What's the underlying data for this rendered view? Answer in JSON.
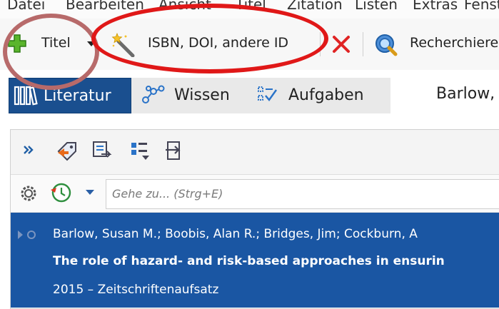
{
  "menubar": {
    "items": [
      "Datei",
      "Bearbeiten",
      "Ansicht",
      "Titel",
      "Zitation",
      "Listen",
      "Extras",
      "Fenster"
    ]
  },
  "toolbar": {
    "new_title_label": "Titel",
    "isbn_label": "ISBN, DOI, andere ID",
    "research_label": "Recherchieren"
  },
  "tabs": {
    "literature": "Literatur",
    "knowledge": "Wissen",
    "tasks": "Aufgaben",
    "right_label": "Barlow,"
  },
  "search": {
    "placeholder": "Gehe zu... (Strg+E)"
  },
  "selected_item": {
    "authors": "Barlow, Susan M.; Boobis, Alan R.; Bridges, Jim; Cockburn, A",
    "title": "The role of hazard- and risk-based approaches in ensurin",
    "meta": "2015 – Zeitschriftenaufsatz"
  },
  "colors": {
    "tab_active": "#1a4f8f",
    "selection": "#1a56a3",
    "annotation_red": "#e01818"
  }
}
